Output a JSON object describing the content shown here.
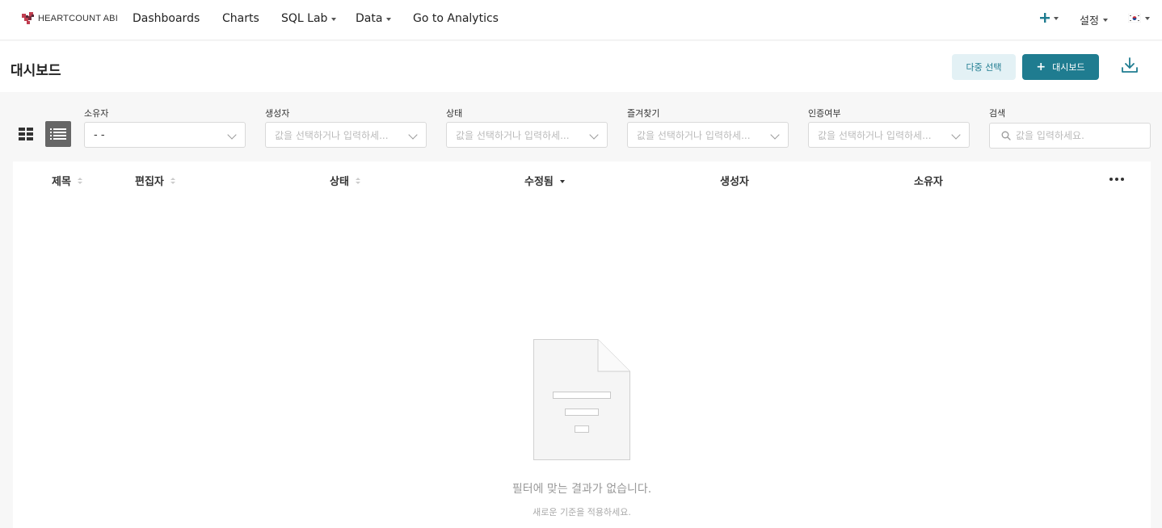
{
  "nav": {
    "logo_text": "HEARTCOUNT ABI",
    "items": [
      {
        "label": "Dashboards"
      },
      {
        "label": "Charts"
      },
      {
        "label": "SQL Lab"
      },
      {
        "label": "Data"
      },
      {
        "label": "Go to Analytics"
      }
    ],
    "settings_label": "설정",
    "accent": "#1f7c90"
  },
  "header": {
    "title": "대시보드",
    "multi_select_label": "다중 선택",
    "add_dashboard_label": "대시보드",
    "add_plus": "+"
  },
  "filters": {
    "owner": {
      "label": "소유자",
      "value": "- -"
    },
    "creator": {
      "label": "생성자",
      "placeholder": "값을 선택하거나 입력하세..."
    },
    "status": {
      "label": "상태",
      "placeholder": "값을 선택하거나 입력하세..."
    },
    "favorite": {
      "label": "즐겨찾기",
      "placeholder": "값을 선택하거나 입력하세..."
    },
    "certified": {
      "label": "인증여부",
      "placeholder": "값을 선택하거나 입력하세..."
    },
    "search": {
      "label": "검색",
      "placeholder": "값을 입력하세요."
    }
  },
  "table": {
    "columns": [
      "제목",
      "편집자",
      "상태",
      "수정됨",
      "생성자",
      "소유자"
    ]
  },
  "empty": {
    "title": "필터에 맞는 결과가 없습니다.",
    "subtitle": "새로운 기준을 적용하세요."
  }
}
